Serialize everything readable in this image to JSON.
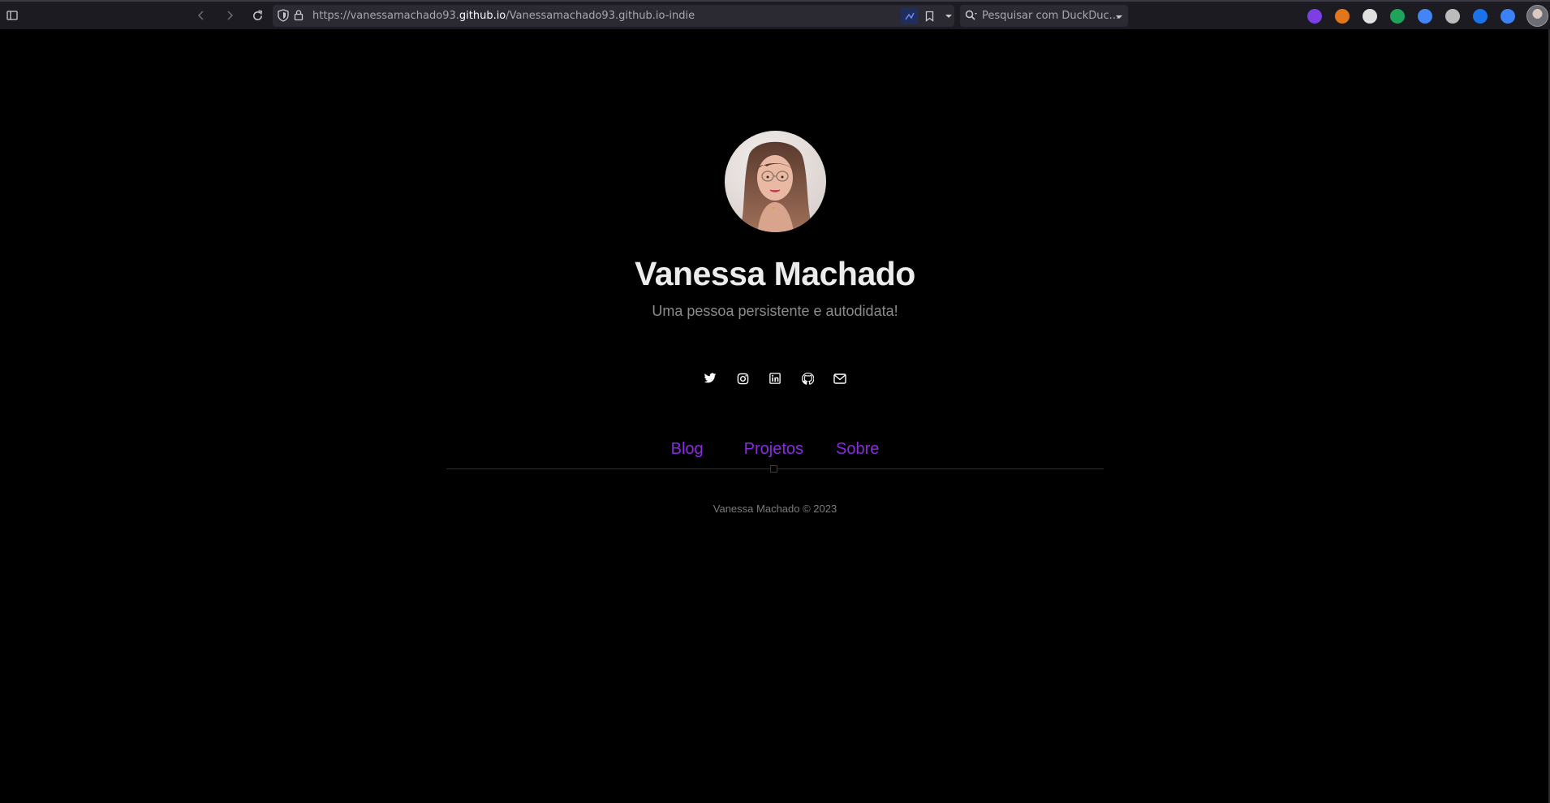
{
  "browser": {
    "url_prefix": "https://vanessamachado93.",
    "url_host": "github.io",
    "url_path": "/Vanessamachado93.github.io-indie",
    "search_placeholder": "Pesquisar com DuckDuc...",
    "extensions": [
      {
        "name": "extension-purple-icon",
        "color": "#7b3fe4"
      },
      {
        "name": "metamask-fox-icon",
        "color": "#e2761b"
      },
      {
        "name": "extension-red-ring-icon",
        "color": "#e0e0e0"
      },
      {
        "name": "extension-green-dollar-icon",
        "color": "#1ea35a"
      },
      {
        "name": "extension-multicolor-icon",
        "color": "#4285f4"
      },
      {
        "name": "extension-screen-icon",
        "color": "#bbbbbb"
      },
      {
        "name": "translate-extension-icon",
        "color": "#1a73e8"
      },
      {
        "name": "extension-puzzle-blue-icon",
        "color": "#3b82f6"
      }
    ]
  },
  "profile": {
    "name": "Vanessa Machado",
    "tagline": "Uma pessoa persistente e autodidata!"
  },
  "socials": [
    {
      "name": "twitter-icon"
    },
    {
      "name": "instagram-icon"
    },
    {
      "name": "linkedin-icon"
    },
    {
      "name": "github-icon"
    },
    {
      "name": "email-icon"
    }
  ],
  "nav": {
    "blog": "Blog",
    "projects": "Projetos",
    "about": "Sobre"
  },
  "footer": {
    "text": "Vanessa Machado © 2023"
  },
  "colors": {
    "background": "#000000",
    "name": "#ececec",
    "tagline": "#8c8c8c",
    "link": "#8a2be2",
    "footer": "#7a7a7a"
  }
}
